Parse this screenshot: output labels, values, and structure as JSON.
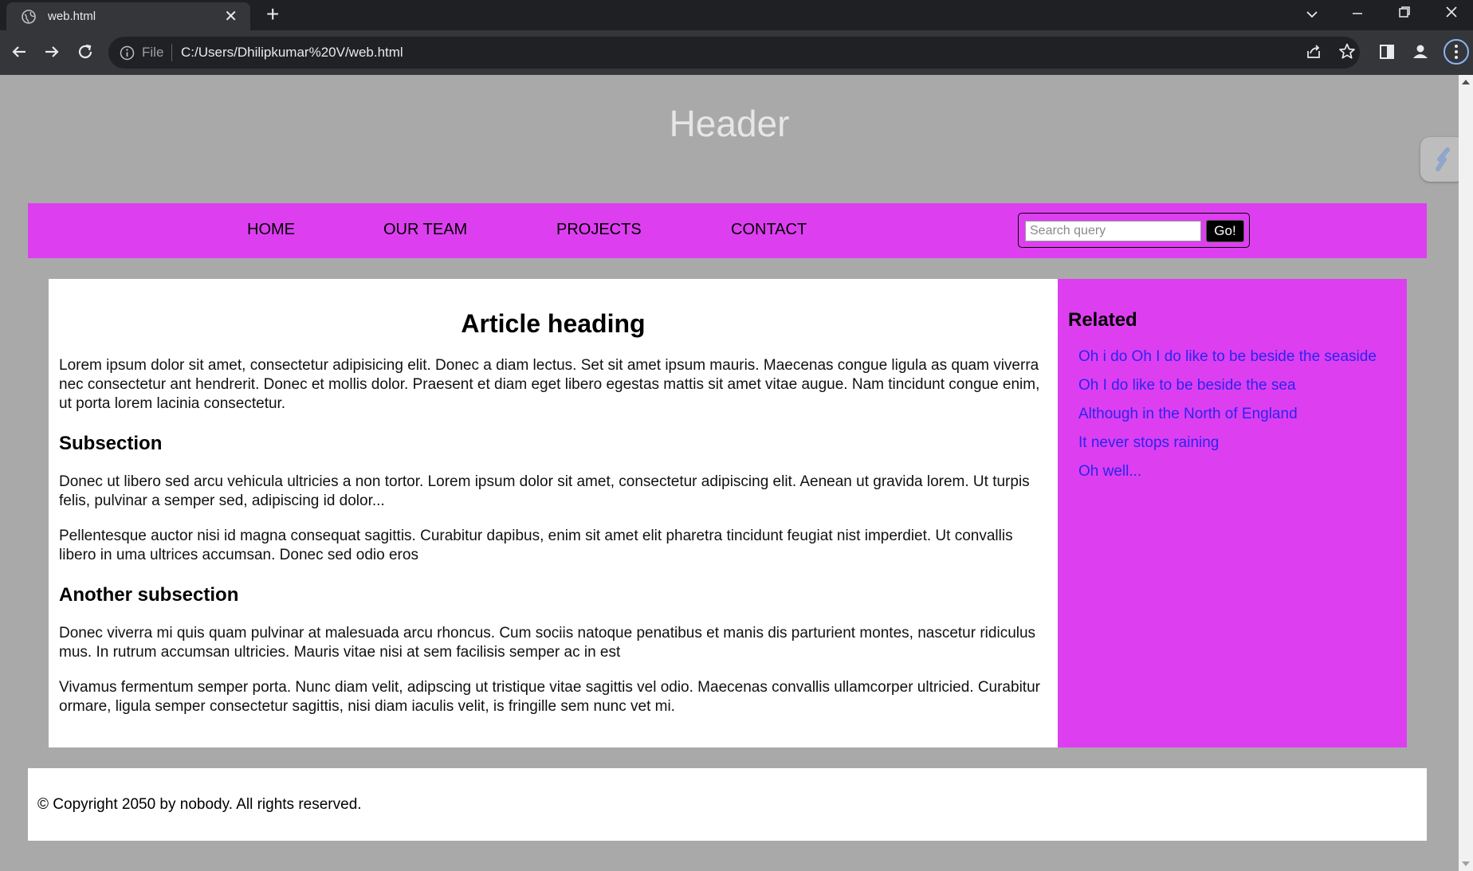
{
  "browser": {
    "tab_title": "web.html",
    "new_tab_symbol": "+",
    "close_symbol": "✕",
    "omnibox_scheme": "File",
    "url": "C:/Users/Dhilipkumar%20V/web.html"
  },
  "page": {
    "header": "Header",
    "nav": {
      "items": [
        {
          "label": "HOME"
        },
        {
          "label": "OUR TEAM"
        },
        {
          "label": "PROJECTS"
        },
        {
          "label": "CONTACT"
        }
      ],
      "search_placeholder": "Search query",
      "search_button": "Go!"
    },
    "article": {
      "heading": "Article heading",
      "intro": "Lorem ipsum dolor sit amet, consectetur adipisicing elit. Donec a diam lectus. Set sit amet ipsum mauris. Maecenas congue ligula as quam viverra nec consectetur ant hendrerit. Donec et mollis dolor. Praesent et diam eget libero egestas mattis sit amet vitae augue. Nam tincidunt congue enim, ut porta lorem lacinia consectetur.",
      "subsection_1": {
        "title": "Subsection",
        "p1": "Donec ut libero sed arcu vehicula ultricies a non tortor. Lorem ipsum dolor sit amet, consectetur adipiscing elit. Aenean ut gravida lorem. Ut turpis felis, pulvinar a semper sed, adipiscing id dolor...",
        "p2": "Pellentesque auctor nisi id magna consequat sagittis. Curabitur dapibus, enim sit amet elit pharetra tincidunt feugiat nist imperdiet. Ut convallis libero in uma ultrices accumsan. Donec sed odio eros"
      },
      "subsection_2": {
        "title": "Another subsection",
        "p1": "Donec viverra mi quis quam pulvinar at malesuada arcu rhoncus. Cum sociis natoque penatibus et manis dis parturient montes, nascetur ridiculus mus. In rutrum accumsan ultricies. Mauris vitae nisi at sem facilisis semper ac in est",
        "p2": "Vivamus fermentum semper porta. Nunc diam velit, adipscing ut tristique vitae sagittis vel odio. Maecenas convallis ullamcorper ultricied. Curabitur ormare, ligula semper consectetur sagittis, nisi diam iaculis velit, is fringille sem nunc vet mi."
      }
    },
    "sidebar": {
      "title": "Related",
      "links": [
        {
          "label": "Oh i do Oh I do like to be beside the seaside"
        },
        {
          "label": "Oh I do like to be beside the sea"
        },
        {
          "label": "Although in the North of England"
        },
        {
          "label": "It never stops raining"
        },
        {
          "label": "Oh well..."
        }
      ]
    },
    "footer": "© Copyright 2050 by nobody. All rights reserved."
  },
  "colors": {
    "page_background": "#a9a9a9",
    "accent_magenta": "#dd3ff0",
    "link_blue": "#2b24f0",
    "header_text": "#e6e6e6",
    "browser_frame": "#35363a"
  },
  "icons": [
    "globe-icon",
    "back-arrow-icon",
    "forward-arrow-icon",
    "reload-icon",
    "info-icon",
    "share-icon",
    "star-icon",
    "sidepanel-icon",
    "profile-icon",
    "menu-dots-icon",
    "tab-search-chevron-icon",
    "minimize-icon",
    "restore-icon",
    "close-icon",
    "extension-icon"
  ]
}
